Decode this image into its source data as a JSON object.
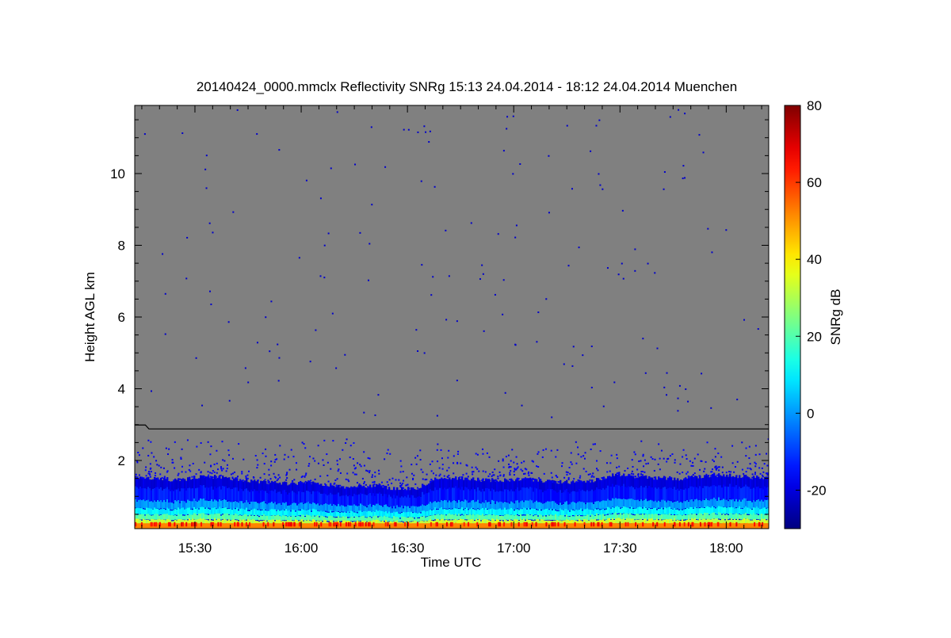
{
  "chart_data": {
    "type": "heatmap",
    "title": "20140424_0000.mmclx Reflectivity SNRg   15:13 24.04.2014 - 18:12 24.04.2014 Muenchen",
    "xlabel": "Time UTC",
    "ylabel": "Height AGL km",
    "x_range": [
      "15:13",
      "18:12"
    ],
    "x_ticks": [
      "15:30",
      "16:00",
      "16:30",
      "17:00",
      "17:30",
      "18:00"
    ],
    "y_range": [
      0.1,
      11.9
    ],
    "y_ticks": [
      2,
      4,
      6,
      8,
      10
    ],
    "colorbar": {
      "label": "SNRg dB",
      "range": [
        -30,
        80
      ],
      "ticks": [
        -20,
        0,
        20,
        40,
        60,
        80
      ],
      "colormap": "jet"
    },
    "background_color": "#808080",
    "boundary_line": [
      {
        "t": "15:13",
        "km": 2.99
      },
      {
        "t": "15:16",
        "km": 2.99
      },
      {
        "t": "15:17",
        "km": 2.88
      },
      {
        "t": "18:12",
        "km": 2.88
      }
    ],
    "echo_profile": {
      "description_units": "height in km",
      "top_km": [
        1.55,
        1.5,
        1.45,
        1.55,
        1.55,
        1.45,
        1.4,
        1.35,
        1.4,
        1.3,
        1.25,
        1.3,
        1.2,
        1.25,
        1.55,
        1.5,
        1.45,
        1.45,
        1.5,
        1.4,
        1.4,
        1.45,
        1.6,
        1.55,
        1.5,
        1.5,
        1.55,
        1.6,
        1.55,
        1.5
      ],
      "scatter_top_km": 2.7,
      "strong_layer_top_km": 0.55,
      "surface_layer_top_km": 0.25
    }
  }
}
